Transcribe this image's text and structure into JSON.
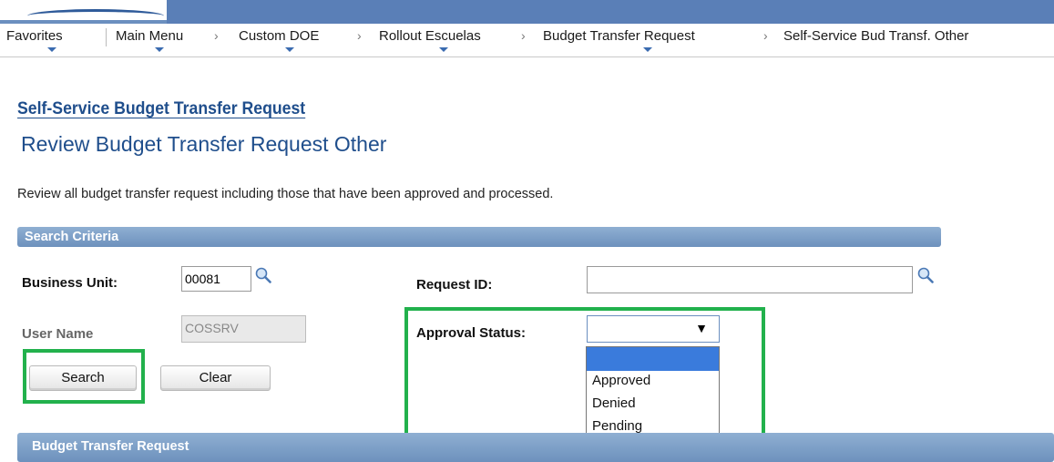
{
  "nav": {
    "items": [
      "Favorites",
      "Main Menu",
      "Custom DOE",
      "Rollout Escuelas",
      "Budget Transfer Request",
      "Self-Service Bud Transf. Other"
    ],
    "separator": "›"
  },
  "breadcrumb_link": "Self-Service Budget Transfer Request",
  "page_title": "Review Budget Transfer Request Other",
  "instructions": "Review all budget transfer request including those that have been approved and processed.",
  "search_criteria": {
    "header": "Search Criteria",
    "business_unit": {
      "label": "Business Unit:",
      "value": "00081"
    },
    "user_name": {
      "label": "User Name",
      "value": "COSSRV"
    },
    "request_id": {
      "label": "Request ID:",
      "value": ""
    },
    "approval_status": {
      "label": "Approval Status:",
      "value": "",
      "options": [
        "",
        "Approved",
        "Denied",
        "Pending"
      ]
    }
  },
  "buttons": {
    "search": "Search",
    "clear": "Clear"
  },
  "results_header": "Budget Transfer Request",
  "colors": {
    "header_blue": "#6d91bd",
    "title_blue": "#1f4e8c",
    "highlight_green": "#22b14c"
  },
  "icons": {
    "lookup": "magnifier-icon",
    "dropdown": "caret-down-icon",
    "nav_menu": "menu-arrow-icon"
  }
}
